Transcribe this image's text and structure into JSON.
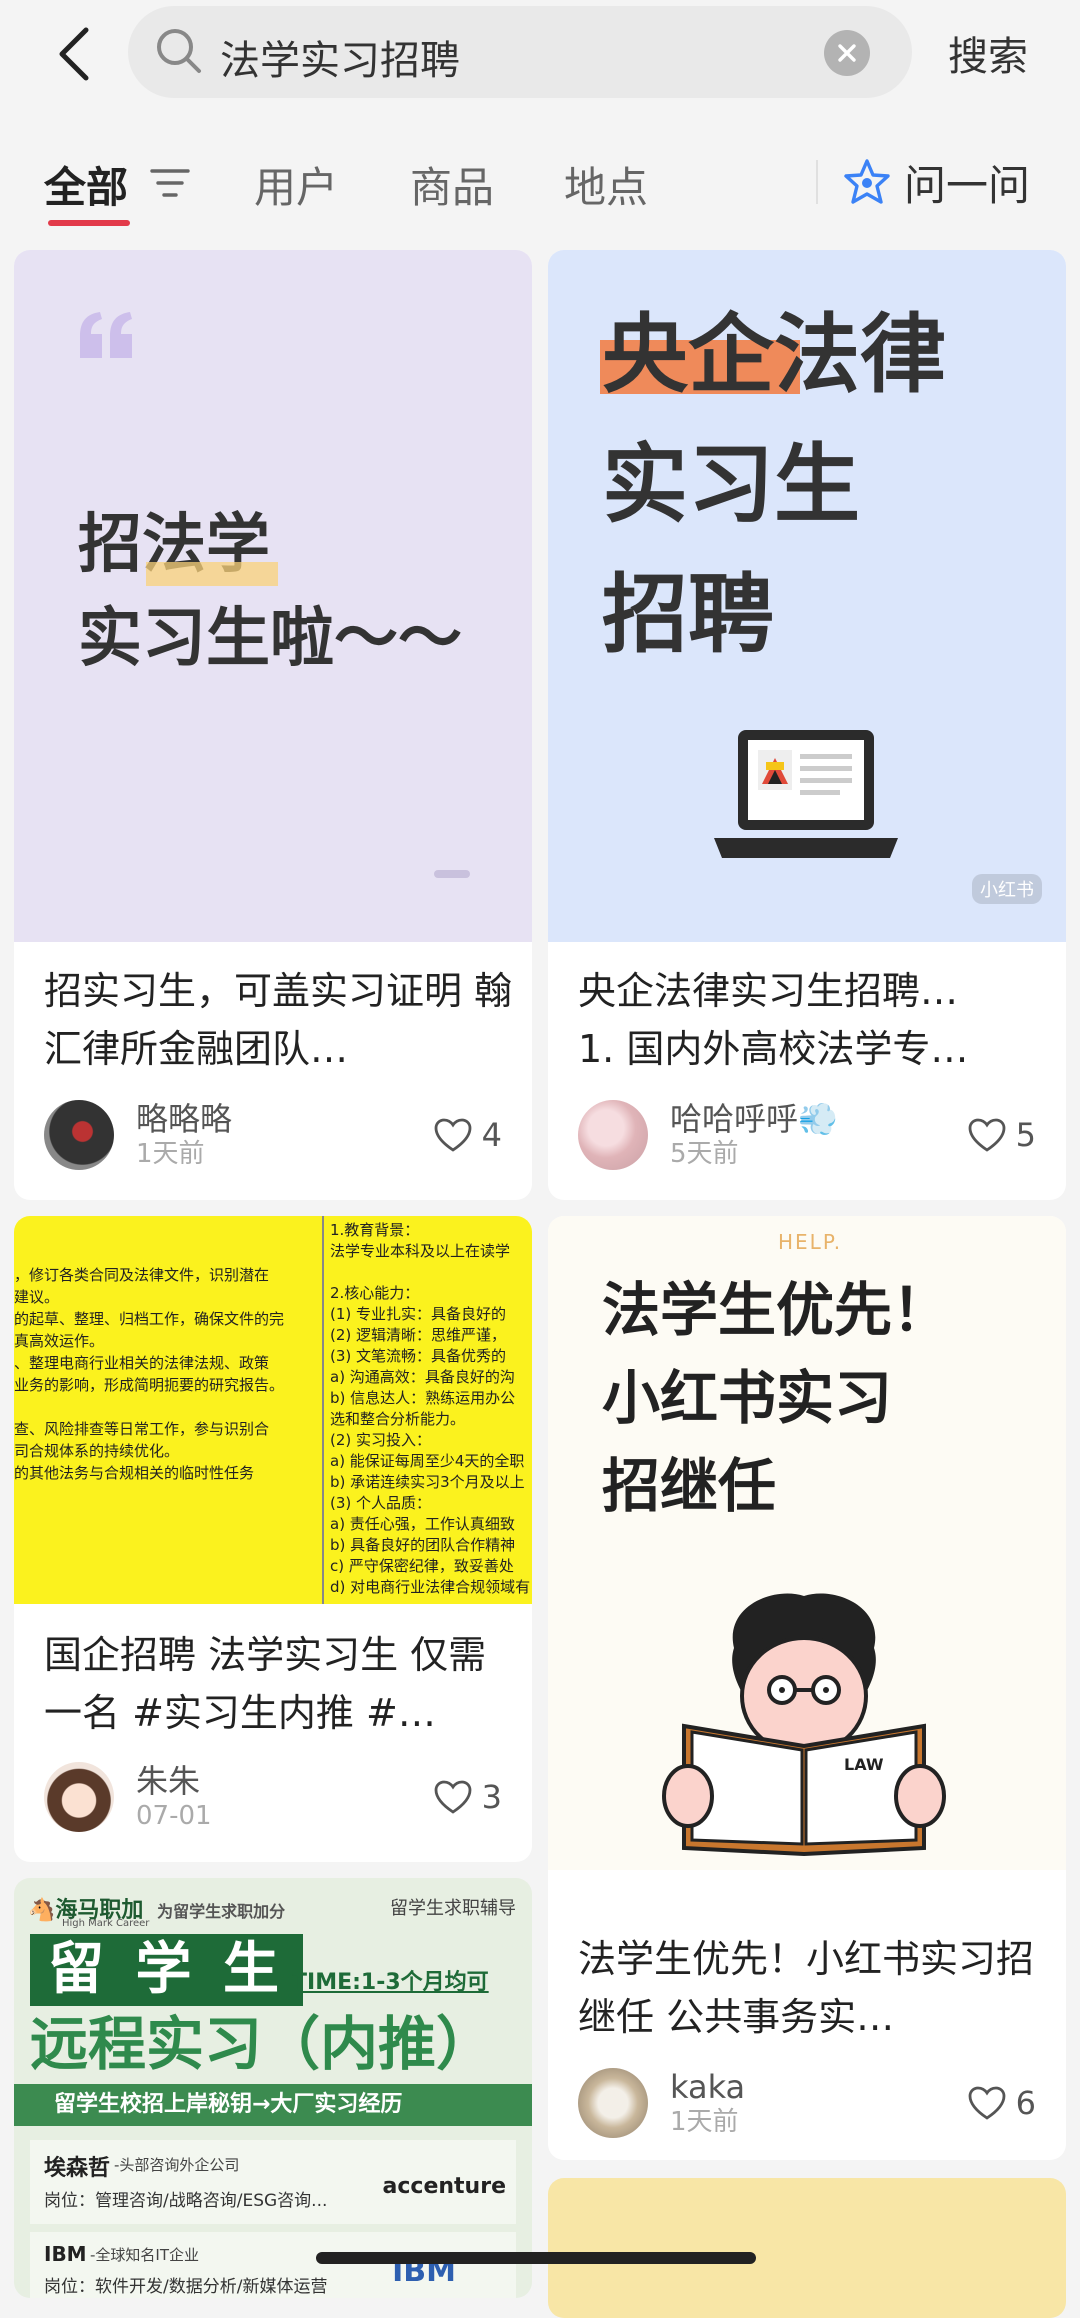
{
  "search": {
    "query": "法学实习招聘",
    "button": "搜索"
  },
  "tabs": [
    {
      "label": "全部"
    },
    {
      "label": "用户"
    },
    {
      "label": "商品"
    },
    {
      "label": "地点"
    }
  ],
  "ask": {
    "label": "问一问"
  },
  "cards": [
    {
      "cover_line1": "招法学",
      "cover_line2": "实习生啦～～",
      "title": "招实习生，可盖实习证明 翰汇律所金融团队…",
      "author": "略略略",
      "time": "1天前",
      "likes": "4"
    },
    {
      "cover_line1a": "央企",
      "cover_line1b": "法律",
      "cover_line2": "实习生",
      "cover_line3": "招聘",
      "watermark": "小红书",
      "title": "央企法律实习生招聘…\n1. 国内外高校法学专…",
      "author": "哈哈呼呼💨",
      "time": "5天前",
      "likes": "5"
    },
    {
      "cover_right": [
        "1.教育背景：",
        "法学专业本科及以上在读学",
        "",
        "2.核心能力：",
        "(1) 专业扎实：具备良好的",
        "(2) 逻辑清晰：思维严谨，",
        "(3) 文笔流畅：具备优秀的",
        "a) 沟通高效：具备良好的沟",
        "b) 信息达人：熟练运用办公",
        "选和整合分析能力。",
        "(2) 实习投入：",
        "a) 能保证每周至少4天的全职",
        "b) 承诺连续实习3个月及以上",
        "(3) 个人品质：",
        "a) 责任心强，工作认真细致",
        "b) 具备良好的团队合作精神",
        "c) 严守保密纪律，致妥善处",
        "d) 对电商行业法律合规领域有"
      ],
      "cover_left": [
        "",
        "",
        "，修订各类合同及法律文件，识别潜在",
        "建议。",
        "的起草、整理、归档工作，确保文件的完",
        "真高效运作。",
        "、整理电商行业相关的法律法规、政策",
        "业务的影响，形成简明扼要的研究报告。",
        "",
        "查、风险排查等日常工作，参与识别合",
        "司合规体系的持续优化。",
        "的其他法务与合规相关的临时性任务"
      ],
      "title": "国企招聘 法学实习生 仅需一名 #实习生内推 #…",
      "author": "朱朱",
      "time": "07-01",
      "likes": "3"
    },
    {
      "cover_help": "HELP.",
      "cover_line1": "法学生优先！",
      "cover_line2": "小红书实习",
      "cover_line3": "招继任",
      "book_label": "LAW",
      "title": "法学生优先！小红书实习招继任 公共事务实…",
      "author": "kaka",
      "time": "1天前",
      "likes": "6"
    },
    {
      "brand": "海马职加",
      "brand_sub": "为留学生求职加分",
      "brand_en": "High Mark Career",
      "tagline": "留学生求职辅导",
      "headline1": "留 学 生",
      "time_text": "TIME:1-3个月均可",
      "headline2": "远程实习（内推）",
      "banner": "留学生校招上岸秘钥→大厂实习经历",
      "company1": "埃森哲",
      "company1_desc": "-头部咨询外企公司",
      "company1_pos": "岗位：管理咨询/战略咨询/ESG咨询...",
      "company1_logo": "accenture",
      "company2": "IBM",
      "company2_desc": "-全球知名IT企业",
      "company2_pos": "岗位：软件开发/数据分析/新媒体运营",
      "company2_logo": "IBM"
    }
  ],
  "colors": {
    "accent": "#e23a4a",
    "highlight_orange": "#f07a4a",
    "highlight_yellow": "#f9d27a",
    "yellow": "#fbf21e",
    "green": "#3c8b50"
  }
}
